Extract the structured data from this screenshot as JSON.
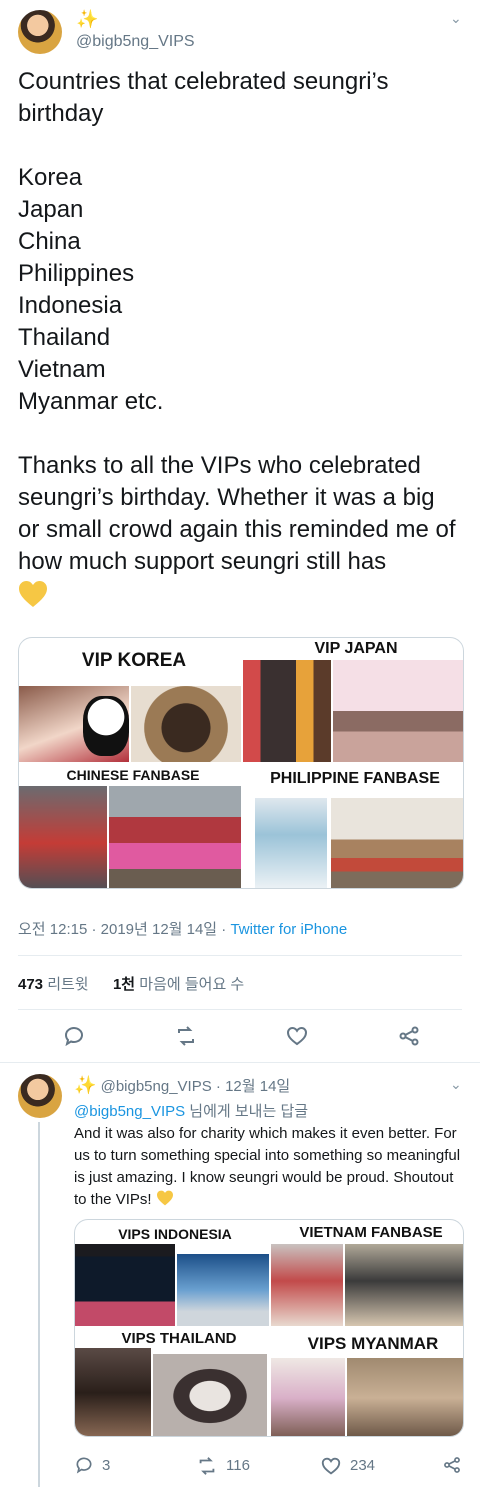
{
  "tweet": {
    "handle": "@bigb5ng_VIPS",
    "sparkle": "✨",
    "text_title": "Countries that celebrated seungri’s birthday",
    "countries": [
      "Korea",
      "Japan",
      "China",
      "Philippines",
      "Indonesia",
      "Thailand",
      "Vietnam",
      "Myanmar etc."
    ],
    "thanks": "Thanks to all the VIPs who celebrated seungri’s birthday. Whether it was a big or small crowd again this reminded me of how much support seungri still has",
    "media_labels": [
      "VIP KOREA",
      "VIP JAPAN",
      "CHINESE FANBASE",
      "PHILIPPINE FANBASE"
    ],
    "timestamp": "오전 12:15 · 2019년 12월 14일 · ",
    "source": "Twitter for iPhone",
    "retweets_count": "473",
    "retweets_label": "리트윗",
    "likes_count": "1천",
    "likes_label": "마음에 들어요 수"
  },
  "reply": {
    "handle": "@bigb5ng_VIPS",
    "sparkle": "✨",
    "date": "· 12월 14일",
    "replying_to": "@bigb5ng_VIPS",
    "replying_suffix": " 님에게 보내는 답글",
    "text": "And it was also for charity which makes it even better. For us to turn something special into something so meaningful is just amazing. I know seungri would be proud. Shoutout to the VIPs!",
    "media_labels": [
      "VIPS INDONESIA",
      "VIETNAM FANBASE",
      "VIPS THAILAND",
      "VIPS MYANMAR"
    ],
    "replies": "3",
    "retweets": "116",
    "likes": "234"
  },
  "colors": {
    "link": "#1b95e0",
    "gray": "#657786",
    "heart": "#f6c744"
  }
}
